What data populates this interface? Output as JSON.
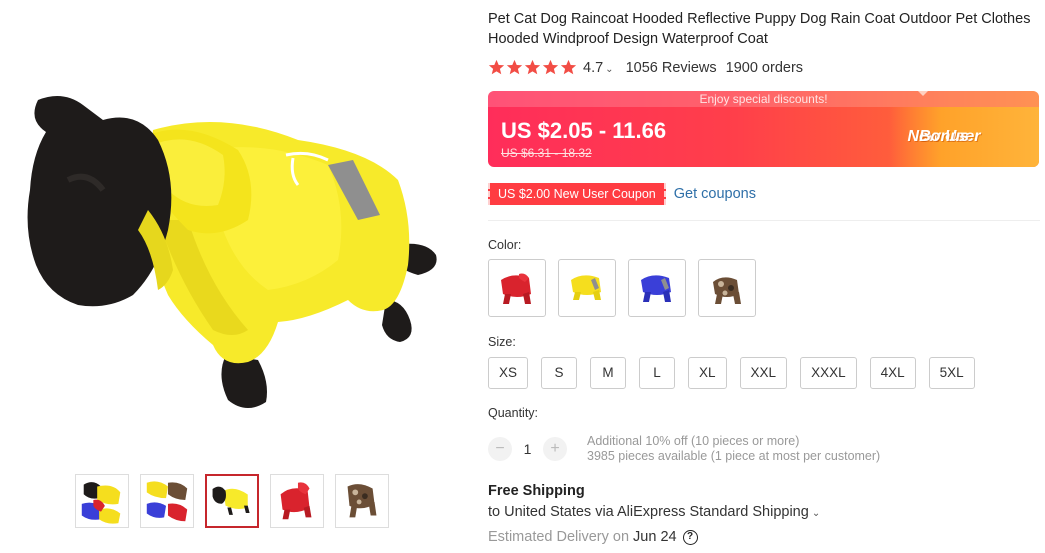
{
  "product": {
    "title": "Pet Cat Dog Raincoat Hooded Reflective Puppy Dog Rain Coat Outdoor Pet Clothes Hooded Windproof Design Waterproof Coat"
  },
  "rating": {
    "value": "4.7",
    "stars": 5,
    "reviews": "1056 Reviews",
    "orders": "1900 orders"
  },
  "price": {
    "banner_text": "Enjoy special discounts!",
    "current": "US $2.05 - 11.66",
    "original": "US $6.31 - 18.32",
    "badge_line1": "New User",
    "badge_line2": "Bonus"
  },
  "coupon": {
    "tag": "US $2.00 New User Coupon",
    "link": "Get coupons"
  },
  "color": {
    "label": "Color:",
    "options": [
      {
        "name": "red",
        "hex": "#d9232d"
      },
      {
        "name": "yellow",
        "hex": "#f5de1e"
      },
      {
        "name": "blue",
        "hex": "#3a3fd8"
      },
      {
        "name": "camouflage",
        "hex": "#6b4e36"
      }
    ]
  },
  "size": {
    "label": "Size:",
    "options": [
      "XS",
      "S",
      "M",
      "L",
      "XL",
      "XXL",
      "XXXL",
      "4XL",
      "5XL"
    ]
  },
  "quantity": {
    "label": "Quantity:",
    "value": "1",
    "minus": "−",
    "plus": "+",
    "note1": "Additional 10% off (10 pieces or more)",
    "note2": "3985 pieces available (1 piece at most per customer)"
  },
  "shipping": {
    "title": "Free Shipping",
    "line": "to United States via AliExpress Standard Shipping",
    "delivery_label": "Estimated Delivery on",
    "delivery_date": "Jun 24",
    "help": "?"
  },
  "gallery": {
    "active_index": 2,
    "thumbs": [
      "multi-color",
      "yellow-camo",
      "yellow",
      "red",
      "camouflage"
    ]
  },
  "colors": {
    "accent": "#ff3c42",
    "link": "#2e6fa8",
    "star": "#f24d45",
    "coat_yellow": "#f7ea2a",
    "mannequin": "#1e1b1a"
  }
}
